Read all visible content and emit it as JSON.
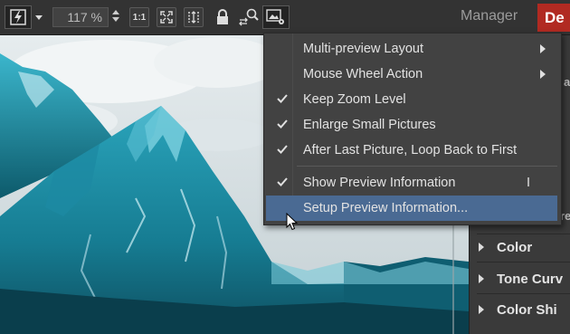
{
  "toolbar": {
    "zoom_value": "117 %",
    "ratio_label": "1:1",
    "module_manager": "Manager",
    "module_develop": "De"
  },
  "menu": {
    "items": [
      {
        "label": "Multi-preview Layout",
        "checked": false,
        "submenu": true
      },
      {
        "label": "Mouse Wheel Action",
        "checked": false,
        "submenu": true
      },
      {
        "label": "Keep Zoom Level",
        "checked": true
      },
      {
        "label": "Enlarge Small Pictures",
        "checked": true
      },
      {
        "label": "After Last Picture, Loop Back to First",
        "checked": true
      },
      {
        "label": "Show Preview Information",
        "checked": true,
        "shortcut": "I"
      },
      {
        "label": "Setup Preview Information...",
        "checked": false,
        "highlighted": true
      }
    ]
  },
  "right_panel": {
    "sections": [
      "Color",
      "Tone Curv",
      "Color Shi"
    ],
    "partial_labels": [
      "a",
      "re"
    ]
  },
  "colors": {
    "accent_highlight": "#4a6a93",
    "develop_tab": "#b12a22",
    "toolbar_bg": "#333333",
    "menu_bg": "#424242"
  }
}
